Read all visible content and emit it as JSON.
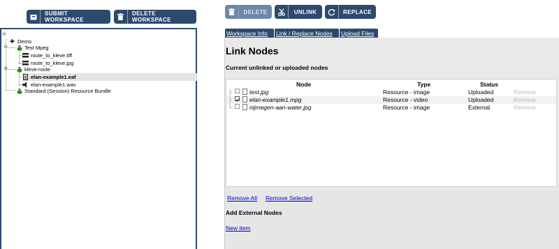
{
  "workspace_toolbar": {
    "submit_label": "SUBMIT WORKSPACE",
    "delete_label": "DELETE WORKSPACE",
    "submit_icon": "archive-box-icon",
    "delete_icon": "trash-icon"
  },
  "node_toolbar": {
    "delete_label": "DELETE",
    "unlink_label": "UNLINK",
    "replace_label": "REPLACE",
    "delete_icon": "trash-icon",
    "unlink_icon": "scissors-icon",
    "replace_icon": "refresh-icon"
  },
  "tree": {
    "nodes": [
      {
        "label": "Demo",
        "icon": "cross-icon"
      },
      {
        "label": "Test Mpeg",
        "icon": "money-bag-icon"
      },
      {
        "label": "route_to_kleve.tiff",
        "icon": "stack-icon"
      },
      {
        "label": "route_to_kleve.jpg",
        "icon": "stack-icon"
      },
      {
        "label": "kleve-route",
        "icon": "money-bag-icon"
      },
      {
        "label": "elan-example1.eaf",
        "icon": "document-icon"
      },
      {
        "label": "elan-example1.wav",
        "icon": "audio-icon"
      },
      {
        "label": "Standard (Session) Resource Bundle",
        "icon": "money-bag-icon"
      }
    ]
  },
  "tabs": [
    "Workspace Info",
    "Link / Replace Nodes",
    "Upload Files"
  ],
  "main": {
    "title": "Link Nodes",
    "section_title": "Current unlinked or uploaded nodes",
    "columns": [
      "Node",
      "Type",
      "Status"
    ],
    "rows": [
      {
        "node": "test.jpg",
        "type": "Resource - image",
        "status": "Uploaded",
        "action": "Remove",
        "checked": false
      },
      {
        "node": "elan-example1.mpg",
        "type": "Resource - video",
        "status": "Uploaded",
        "action": "Remove",
        "checked": true
      },
      {
        "node": "nijmegen-aan-water.jpg",
        "type": "Resource - image",
        "status": "External",
        "action": "Remove",
        "checked": false
      }
    ],
    "remove_all": "Remove All",
    "remove_selected": "Remove Selected",
    "add_external_title": "Add External Nodes",
    "new_item": "New item"
  },
  "colors": {
    "accent": "#2c4a6e",
    "panel": "#e9e9e9",
    "link": "#0000cc"
  }
}
